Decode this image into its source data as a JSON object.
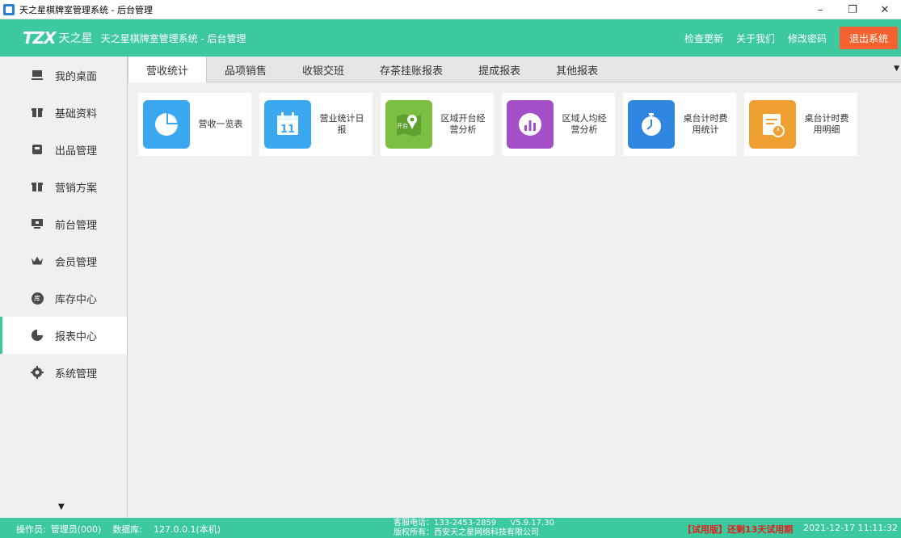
{
  "window": {
    "title": "天之星棋牌室管理系统 - 后台管理",
    "controls": [
      "–",
      "❐",
      "✕"
    ]
  },
  "header": {
    "logo_mark": "TZX",
    "logo_name": "天之星",
    "subtitle": "天之星棋牌室管理系统 - 后台管理",
    "links": [
      "检查更新",
      "关于我们",
      "修改密码"
    ],
    "logout_label": "退出系统",
    "colors": {
      "primary": "#3cc9a0",
      "logout": "#f5622f"
    }
  },
  "sidebar": {
    "items": [
      {
        "label": "我的桌面",
        "icon": "desktop-icon"
      },
      {
        "label": "基础资料",
        "icon": "gift-icon"
      },
      {
        "label": "出品管理",
        "icon": "box-icon"
      },
      {
        "label": "营销方案",
        "icon": "gift-icon"
      },
      {
        "label": "前台管理",
        "icon": "monitor-icon"
      },
      {
        "label": "会员管理",
        "icon": "crown-icon"
      },
      {
        "label": "库存中心",
        "icon": "warehouse-icon",
        "glyph": "库"
      },
      {
        "label": "报表中心",
        "icon": "pie-chart-icon",
        "active": true
      },
      {
        "label": "系统管理",
        "icon": "gear-icon"
      }
    ]
  },
  "tabs": [
    {
      "label": "营收统计",
      "active": true
    },
    {
      "label": "品项销售"
    },
    {
      "label": "收银交班"
    },
    {
      "label": "存茶挂账报表"
    },
    {
      "label": "提成报表"
    },
    {
      "label": "其他报表"
    }
  ],
  "cards": [
    {
      "label": "营收一览表",
      "icon": "pie-chart-icon",
      "color": "#3aa8f0"
    },
    {
      "label": "营业统计日报",
      "icon": "calendar-icon",
      "color": "#3aa8f0",
      "glyph": "11"
    },
    {
      "label": "区域开台经营分析",
      "icon": "map-pin-icon",
      "color": "#7bc043",
      "glyph": "开台"
    },
    {
      "label": "区域人均经营分析",
      "icon": "bar-chart-icon",
      "color": "#a24fc9"
    },
    {
      "label": "桌台计时费用统计",
      "icon": "stopwatch-icon",
      "color": "#2f86e0"
    },
    {
      "label": "桌台计时费用明细",
      "icon": "document-timer-icon",
      "color": "#f0a030"
    }
  ],
  "statusbar": {
    "operator_label": "操作员:",
    "operator_value": "管理员(000)",
    "db_label": "数据库:",
    "db_value": "127.0.0.1(本机)",
    "phone": "客服电话：133-2453-2859",
    "version": "V5.9.17.30",
    "copyright": "版权所有：西安天之星网络科技有限公司",
    "trial": "【试用版】还剩13天试用期",
    "datetime": "2021-12-17 11:11:32"
  }
}
